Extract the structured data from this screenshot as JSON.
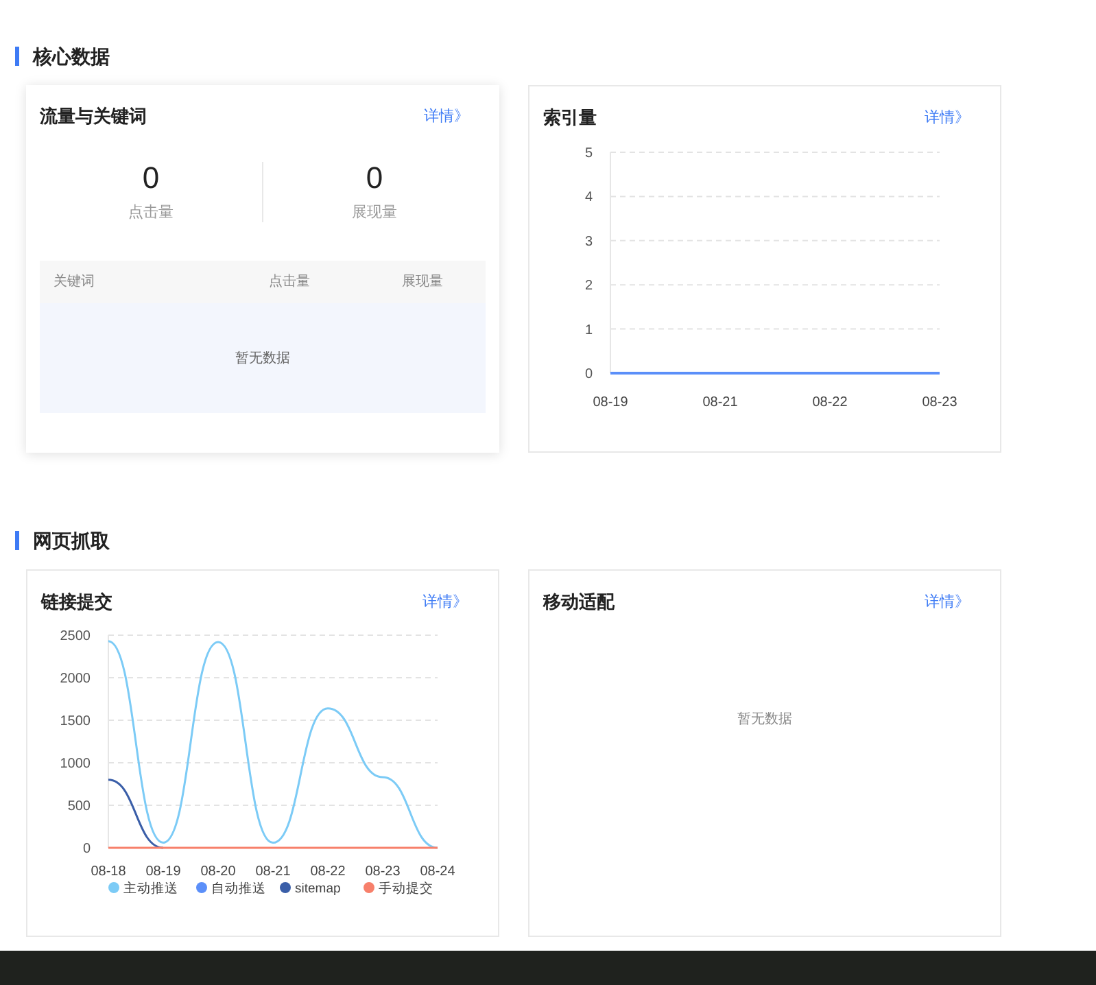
{
  "sections": [
    {
      "title": "核心数据",
      "cards": [
        {
          "kind": "stats_table",
          "raised": true,
          "title": "流量与关键词",
          "link": "详情》",
          "stats": [
            {
              "value": "0",
              "label": "点击量"
            },
            {
              "value": "0",
              "label": "展现量"
            }
          ],
          "table": {
            "columns": [
              "关键词",
              "点击量",
              "展现量"
            ],
            "empty_text": "暂无数据"
          }
        },
        {
          "kind": "chart",
          "raised": false,
          "title": "索引量",
          "link": "详情》",
          "chart_data": {
            "type": "line",
            "grid": true,
            "categories": [
              "08-19",
              "08-21",
              "08-22",
              "08-23"
            ],
            "ylim": [
              0,
              5
            ],
            "yticks": [
              0,
              1,
              2,
              3,
              4,
              5
            ],
            "series": [
              {
                "color": "#5b8ff9",
                "values": [
                  0,
                  0,
                  0,
                  0
                ]
              }
            ]
          }
        }
      ]
    },
    {
      "title": "网页抓取",
      "cards": [
        {
          "kind": "chart",
          "raised": false,
          "title": "链接提交",
          "link": "详情》",
          "chart_data": {
            "type": "line",
            "grid": true,
            "legend": true,
            "categories": [
              "08-18",
              "08-19",
              "08-20",
              "08-21",
              "08-22",
              "08-23",
              "08-24"
            ],
            "ylim": [
              0,
              2500
            ],
            "yticks": [
              0,
              500,
              1000,
              1500,
              2000,
              2500
            ],
            "series": [
              {
                "name": "主动推送",
                "color": "#7ccbf6",
                "values": [
                  2430,
                  60,
                  2420,
                  60,
                  1640,
                  830,
                  0
                ]
              },
              {
                "name": "自动推送",
                "color": "#5b8ff9",
                "values": [
                  null,
                  null,
                  null,
                  null,
                  null,
                  null,
                  null
                ]
              },
              {
                "name": "sitemap",
                "color": "#3a5ea8",
                "values": [
                  800,
                  0,
                  null,
                  null,
                  null,
                  null,
                  null
                ]
              },
              {
                "name": "手动提交",
                "color": "#f7806b",
                "values": [
                  0,
                  0,
                  0,
                  0,
                  0,
                  0,
                  0
                ]
              }
            ]
          }
        },
        {
          "kind": "empty",
          "raised": false,
          "title": "移动适配",
          "link": "详情》",
          "empty_text": "暂无数据"
        }
      ]
    }
  ]
}
